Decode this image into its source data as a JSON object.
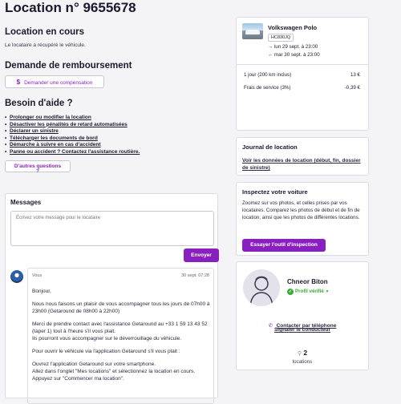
{
  "page_title": "Location n° 9655678",
  "status": {
    "heading": "Location en cours",
    "text": "Le locataire a récupéré le véhicule."
  },
  "refund": {
    "heading": "Demande de remboursement",
    "button_label": "Demander une compensation",
    "button_icon": "dollar-icon"
  },
  "help": {
    "heading": "Besoin d'aide ?",
    "links": [
      "Prolonger ou modifier la location",
      "Désactiver les pénalités de retard automatisées",
      "Déclarer un sinistre",
      "Télécharger les documents de bord",
      "Démarche à suivre en cas d'accident",
      "Panne ou accident ? Contactez l'assistance routière."
    ],
    "more_button": "D'autres questions ?"
  },
  "messages": {
    "heading": "Messages",
    "placeholder": "Écrivez votre message pour le locataire",
    "send_button": "Envoyer",
    "items": [
      {
        "author": "Vous",
        "date": "30 sept. 07:28",
        "paragraphs": [
          "Bonjour,",
          "Nous nous faisons un plaisir de vous accompagner tous les jours de 07h00 à 23h00 (Getaround de 08h00 à 22h00)",
          "Merci de prendre contact avec l'assistance Getaround au +33 1 59 13 43 52 (taper 1) tout à l'heure s'il vous plait.\nIls pourront vous accompagner sur le déverrouillage du véhicule.",
          "Pour ouvrir le véhicule via l'application Getaround s'il vous plait :",
          "Ouvrez l'application Getaround sur votre smartphone.\nAllez dans l'onglet \"Mes locations\" et sélectionnez la location en cours.\nAppuyez sur \"Commencer ma location\"."
        ]
      }
    ]
  },
  "car": {
    "name": "Volkswagen Polo",
    "plate": "HC830JQ",
    "start": "lun 29 sept. à 23:00",
    "end": "mar 30 sept. à 23:00",
    "price_rows": [
      {
        "label": "1 jour (200 km inclus)",
        "value": "13 €"
      },
      {
        "label": "Frais de service (3%)",
        "value": "-0,39 €"
      }
    ]
  },
  "journal": {
    "heading": "Journal de location",
    "link": "Voir les données de location (début, fin, dossier de sinistre)"
  },
  "inspect": {
    "heading": "Inspectez votre voiture",
    "text": "Zoomez sur vos photos, et celles prises par vos locataires. Comparez les photos de début et de fin de location, ainsi que les photos de différentes locations.",
    "button": "Essayer l'outil d'inspection"
  },
  "renter": {
    "name": "Chneor Biton",
    "verified": "Profil vérifié",
    "contact": "Contacter par téléphone",
    "report": "Signaler le conducteur",
    "rentals_count": "2",
    "rentals_label": "locations"
  },
  "colors": {
    "accent": "#8a1fbf",
    "verified": "#3aaa35",
    "background": "#f4f4f6"
  }
}
